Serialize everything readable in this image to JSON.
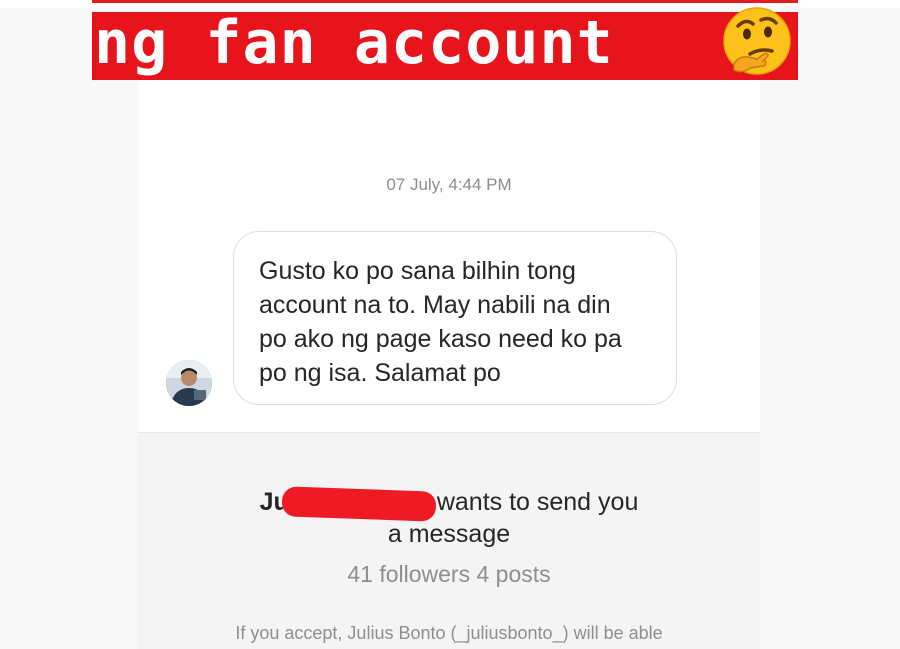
{
  "banner": {
    "text": "ng fan account",
    "icon": "thinking-face-emoji",
    "bg_color": "#e8141c"
  },
  "conversation": {
    "timestamp": "07 July, 4:44 PM",
    "message": "Gusto ko po sana bilhin tong\naccount na to.  May nabili na din\npo ako ng page kaso need ko pa\npo ng isa. Salamat po"
  },
  "request": {
    "name_prefix": "Ju",
    "title_suffix": "wants to send you",
    "title_line2": "a message",
    "stats": "41 followers 4 posts",
    "disclaimer": "If you accept, Julius Bonto (_juliusbonto_) will be able"
  }
}
